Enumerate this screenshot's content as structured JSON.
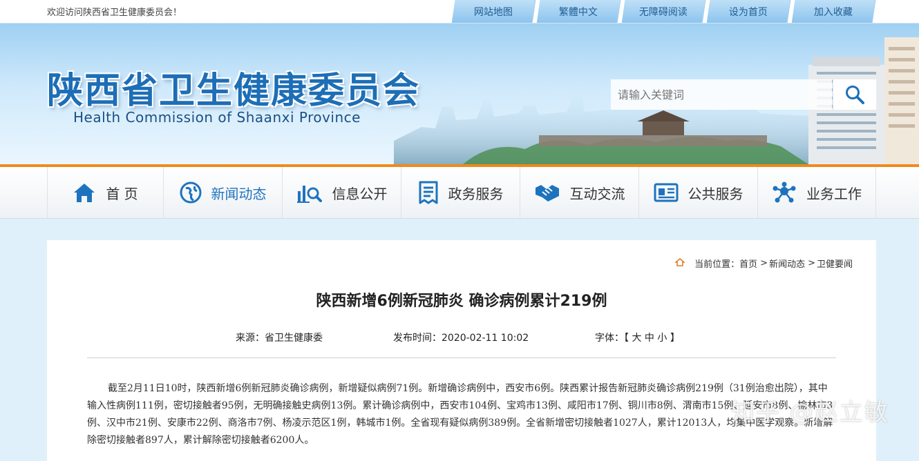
{
  "topbar": {
    "welcome": "欢迎访问陕西省卫生健康委员会！",
    "links": [
      "网站地图",
      "繁體中文",
      "无障碍阅读",
      "设为首页",
      "加入收藏"
    ]
  },
  "header": {
    "title": "陕西省卫生健康委员会",
    "subtitle": "Health Commission of Shaanxi Province",
    "search_placeholder": "请输入关键词"
  },
  "nav": {
    "items": [
      {
        "label": "首 页",
        "icon": "home-icon"
      },
      {
        "label": "新闻动态",
        "icon": "globe-icon",
        "active": true
      },
      {
        "label": "信息公开",
        "icon": "chart-search-icon"
      },
      {
        "label": "政务服务",
        "icon": "document-icon"
      },
      {
        "label": "互动交流",
        "icon": "handshake-icon"
      },
      {
        "label": "公共服务",
        "icon": "id-card-icon"
      },
      {
        "label": "业务工作",
        "icon": "network-icon"
      }
    ]
  },
  "breadcrumb": {
    "prefix": "当前位置：",
    "items": [
      "首页",
      "新闻动态",
      "卫健要闻"
    ]
  },
  "article": {
    "title": "陕西新增6例新冠肺炎 确诊病例累计219例",
    "source_label": "来源：",
    "source": "省卫生健康委",
    "date_label": "发布时间：",
    "date": "2020-02-11 10:02",
    "font_label": "字体：",
    "font_open": "【",
    "font_large": "大",
    "font_medium": "中",
    "font_small": "小",
    "font_close": "】",
    "body": "截至2月11日10时，陕西新增6例新冠肺炎确诊病例，新增疑似病例71例。新增确诊病例中，西安市6例。陕西累计报告新冠肺炎确诊病例219例（31例治愈出院），其中输入性病例111例，密切接触者95例，无明确接触史病例13例。累计确诊病例中，西安市104例、宝鸡市13例、咸阳市17例、铜川市8例、渭南市15例、延安市8例、榆林市3例、汉中市21例、安康市22例、商洛市7例、杨凌示范区1例，韩城市1例。全省现有疑似病例389例。全省新增密切接触者1027人，累计12013人，均集中医学观察。新增解除密切接触者897人，累计解除密切接触者6200人。"
  },
  "watermark": "知乎 @赵立敏"
}
